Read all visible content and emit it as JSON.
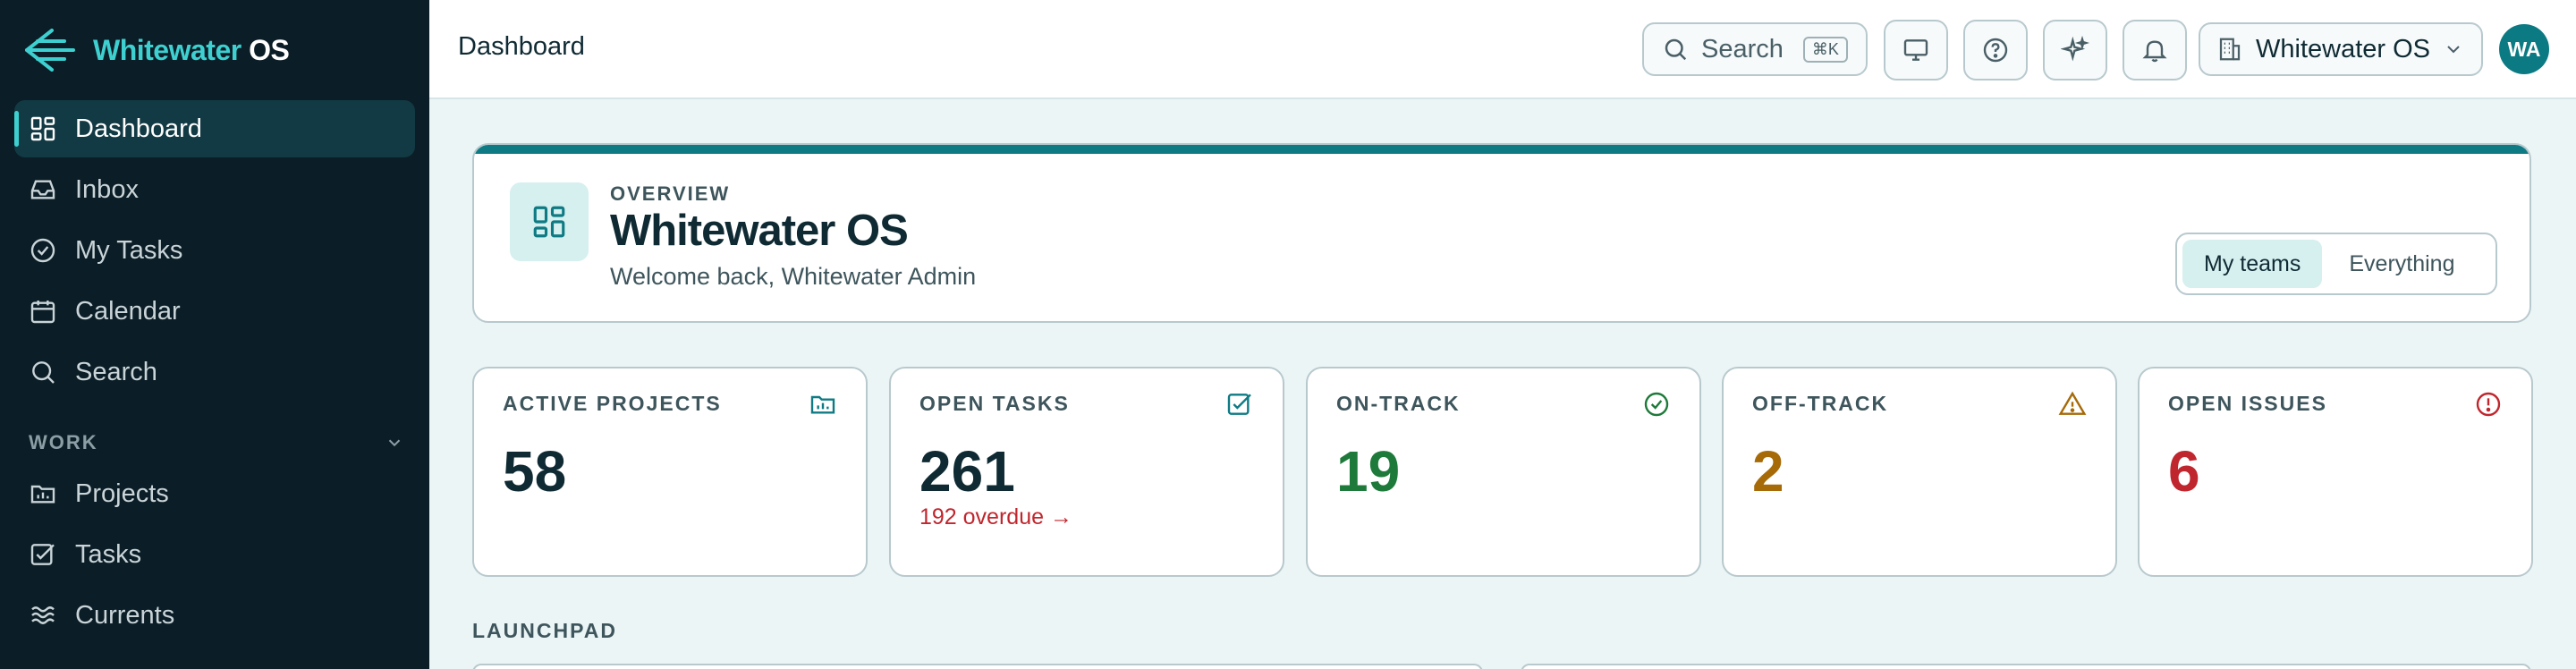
{
  "brand": {
    "name_accent": "Whitewater",
    "name_bold": "OS"
  },
  "sidebar": {
    "items": [
      {
        "label": "Dashboard",
        "icon": "dashboard-icon",
        "active": true
      },
      {
        "label": "Inbox",
        "icon": "inbox-icon"
      },
      {
        "label": "My Tasks",
        "icon": "check-circle-icon"
      },
      {
        "label": "Calendar",
        "icon": "calendar-icon"
      },
      {
        "label": "Search",
        "icon": "search-icon"
      }
    ],
    "section": "WORK",
    "work_items": [
      {
        "label": "Projects",
        "icon": "folder-chart-icon"
      },
      {
        "label": "Tasks",
        "icon": "checkbox-icon"
      },
      {
        "label": "Currents",
        "icon": "waves-icon"
      }
    ]
  },
  "topbar": {
    "title": "Dashboard",
    "search_label": "Search",
    "search_shortcut": "⌘K",
    "workspace": "Whitewater OS",
    "avatar_initials": "WA"
  },
  "overview": {
    "eyebrow": "OVERVIEW",
    "title": "Whitewater OS",
    "subtitle": "Welcome back, Whitewater Admin",
    "scope_options": [
      "My teams",
      "Everything"
    ],
    "scope_selected": "My teams"
  },
  "stats": [
    {
      "label": "ACTIVE PROJECTS",
      "value": "58",
      "color": "#0f2a33",
      "icon": "folder-chart-icon"
    },
    {
      "label": "OPEN TASKS",
      "value": "261",
      "note": "192 overdue →",
      "color": "#0f2a33",
      "icon": "checkbox-icon"
    },
    {
      "label": "ON-TRACK",
      "value": "19",
      "color": "#1e7a3a",
      "icon": "check-circle-icon"
    },
    {
      "label": "OFF-TRACK",
      "value": "2",
      "color": "#a66a08",
      "icon": "warning-icon"
    },
    {
      "label": "OPEN ISSUES",
      "value": "6",
      "color": "#c0262d",
      "icon": "alert-circle-icon"
    }
  ],
  "launchpad": {
    "label": "LAUNCHPAD"
  },
  "colors": {
    "accent": "#3ed0d0",
    "brand_dark": "#0e7b84",
    "sidebar_bg": "#0b1d26",
    "danger": "#c0262d"
  }
}
